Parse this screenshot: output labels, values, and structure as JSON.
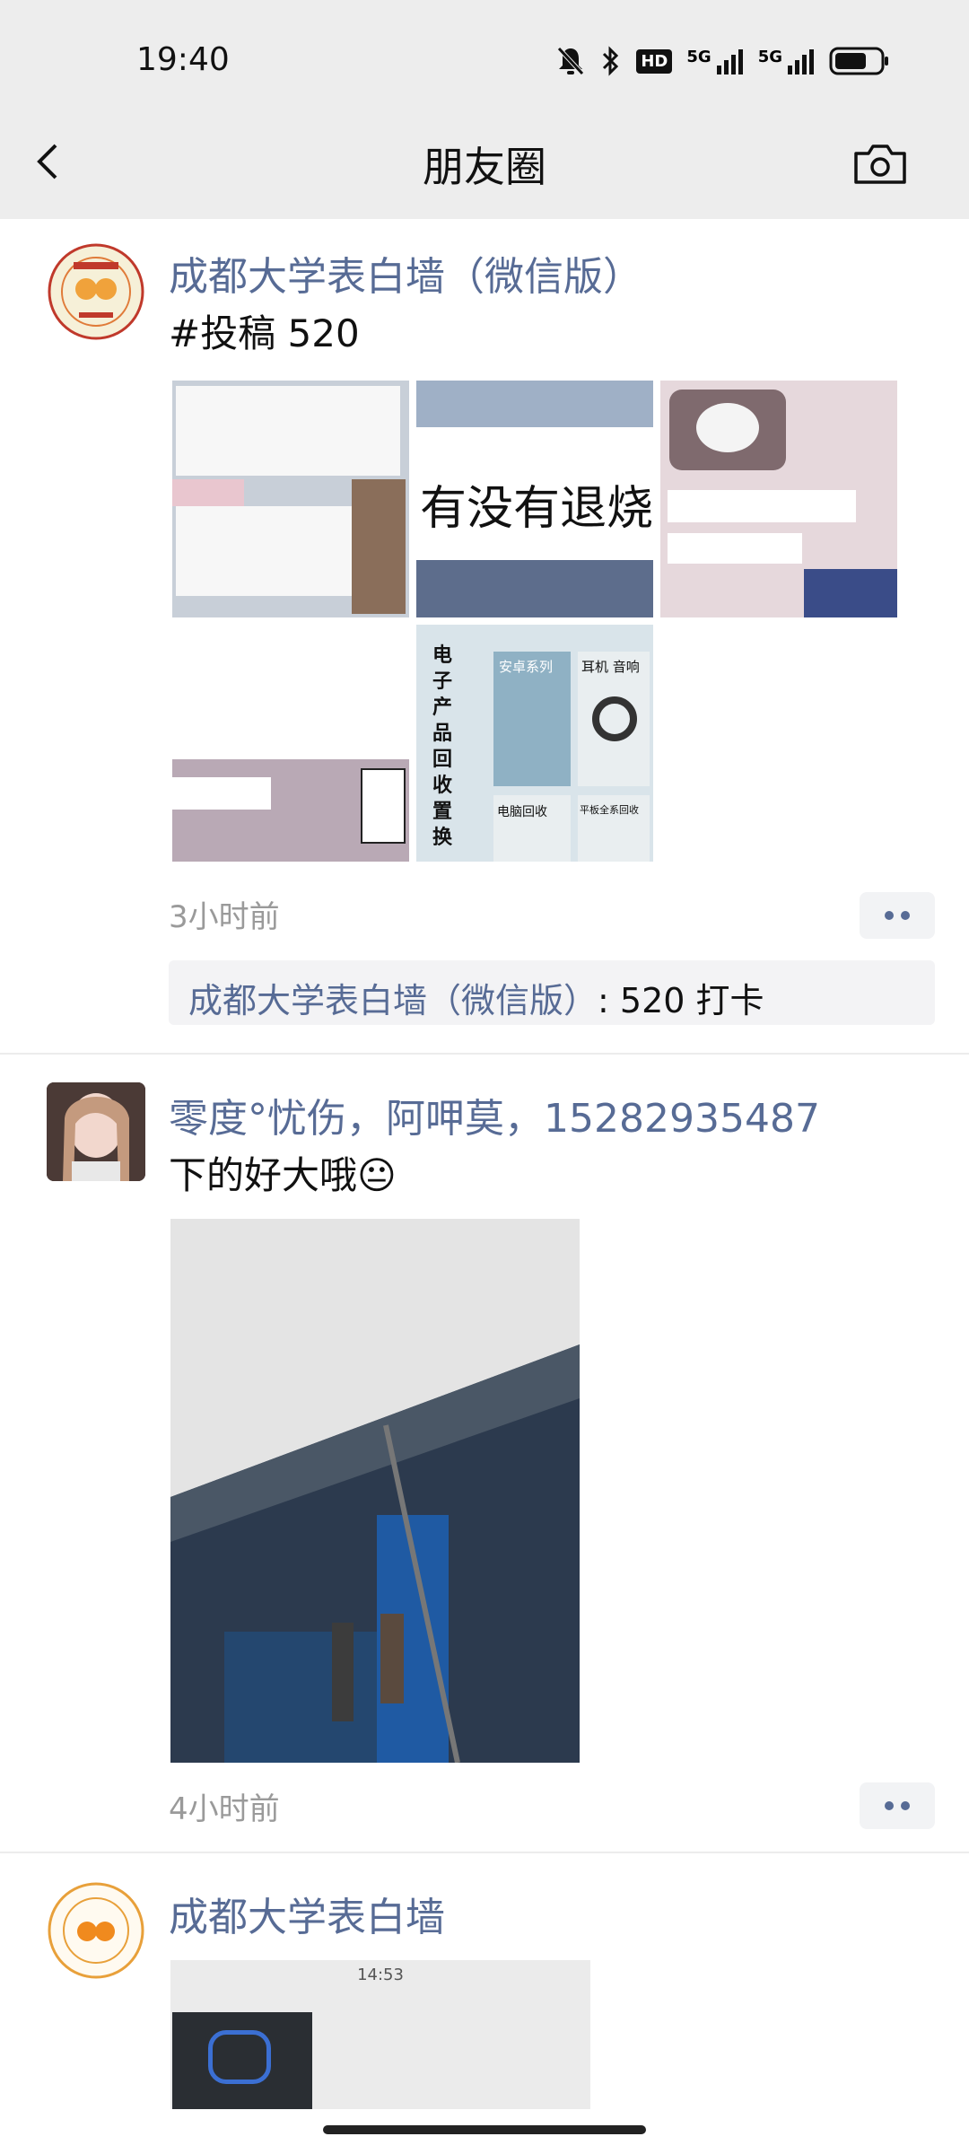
{
  "status": {
    "time": "19:40",
    "hd_label": "HD",
    "net1": "5G",
    "net2": "5G"
  },
  "nav": {
    "title": "朋友圈"
  },
  "posts": [
    {
      "author": "成都大学表白墙（微信版）",
      "text": "#投稿 520",
      "time": "3小时前",
      "images": {
        "img2_text": "有没有退烧",
        "img5_lines": [
          "电",
          "子",
          "产",
          "品",
          "回",
          "收",
          "置",
          "换"
        ],
        "img5_labels": [
          "安卓系列",
          "耳机 音响",
          "电脑回收",
          "平板全系回收"
        ]
      },
      "comment": {
        "name": "成都大学表白墙（微信版）",
        "sep": ":",
        "content": " 520 打卡"
      }
    },
    {
      "author": "零度°忧伤，阿呷莫，15282935487",
      "text": "下的好大哦",
      "emoji": "😐",
      "time": "4小时前"
    },
    {
      "author": "成都大学表白墙",
      "image_time": "14:53"
    }
  ]
}
